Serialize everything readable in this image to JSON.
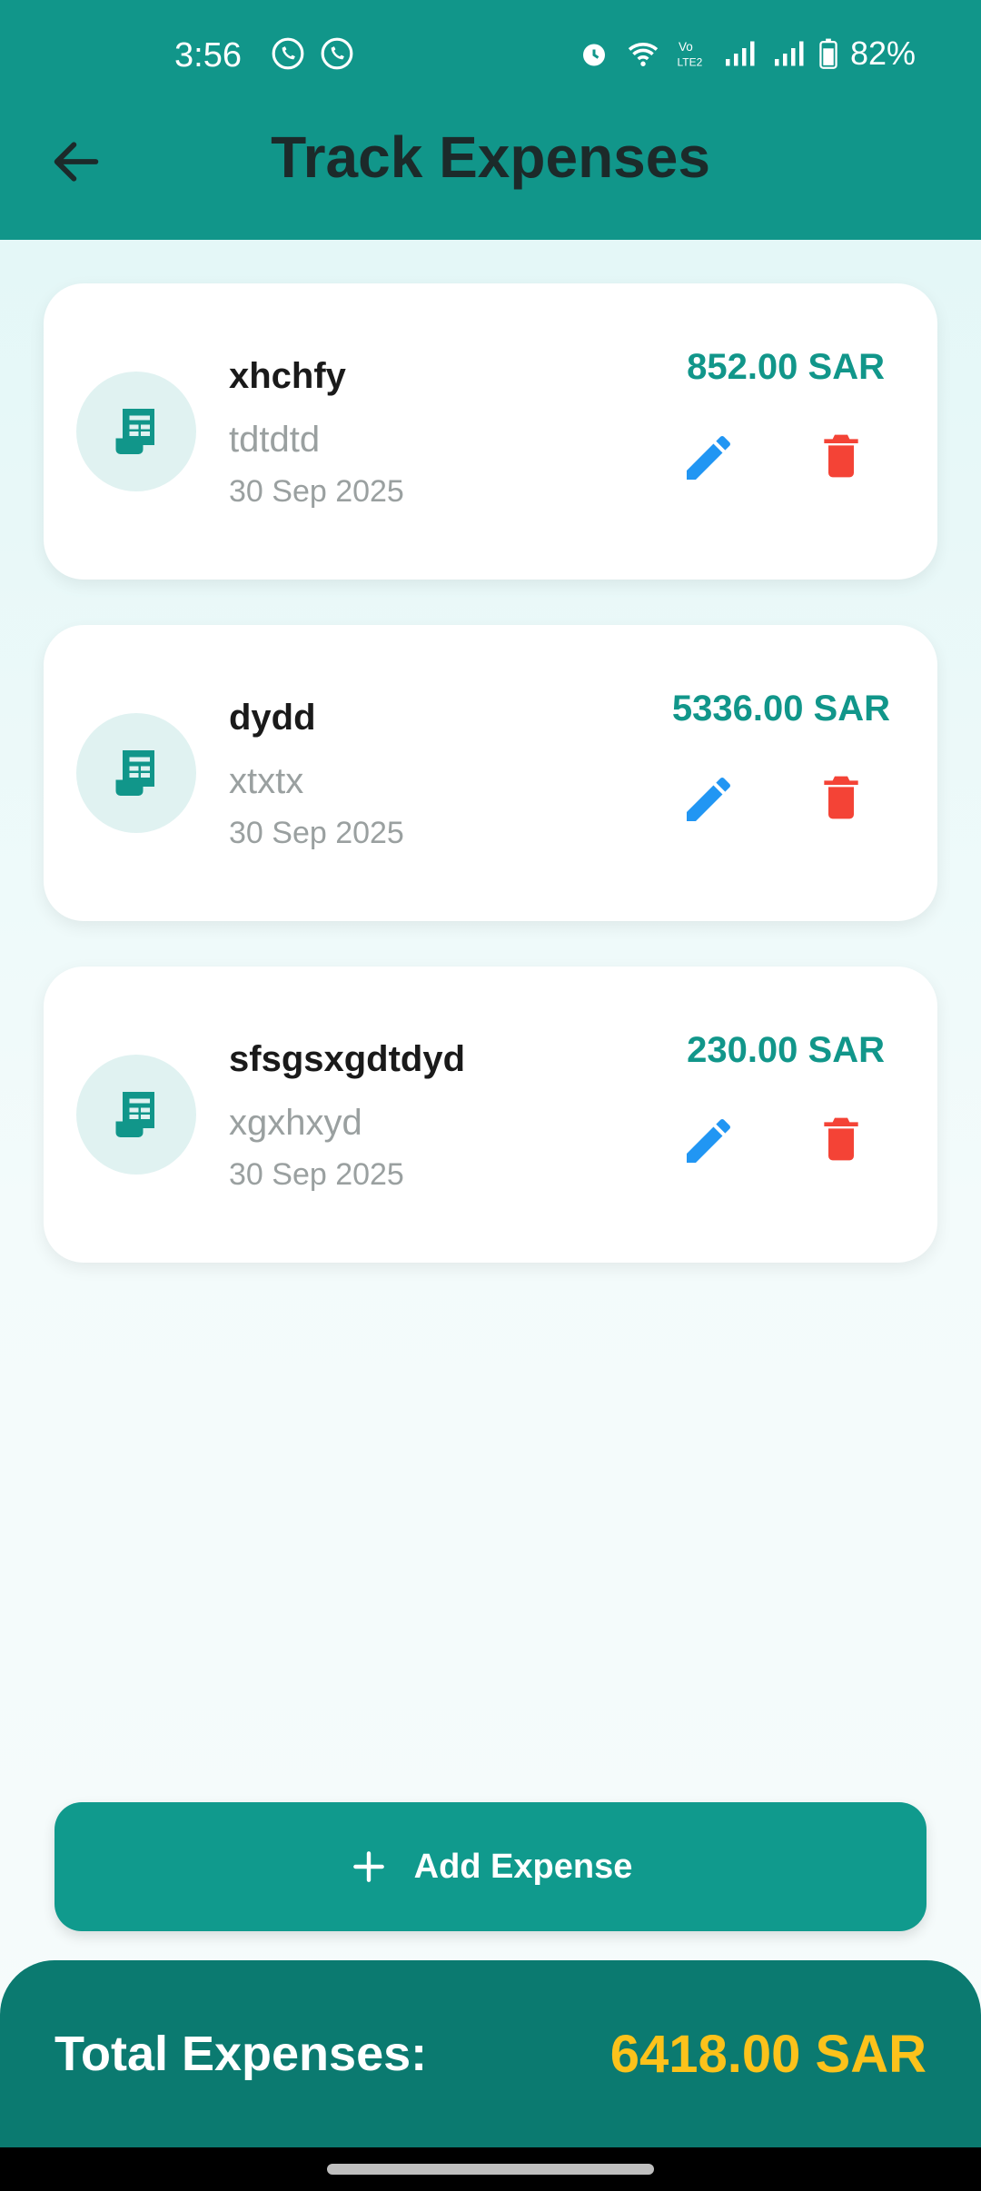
{
  "status_bar": {
    "time": "3:56",
    "battery": "82%",
    "icons": [
      "whatsapp-icon",
      "whatsapp-icon",
      "alarm-icon",
      "wifi-icon",
      "volte-icon",
      "signal-icon",
      "signal-icon",
      "battery-icon"
    ]
  },
  "header": {
    "title": "Track Expenses"
  },
  "expenses": [
    {
      "name": "xhchfy",
      "description": "tdtdtd",
      "date": "30 Sep 2025",
      "amount": "852.00 SAR"
    },
    {
      "name": "dydd",
      "description": "xtxtx",
      "date": "30 Sep 2025",
      "amount": "5336.00 SAR"
    },
    {
      "name": "sfsgsxgdtdyd",
      "description": "xgxhxyd",
      "date": "30 Sep 2025",
      "amount": "230.00 SAR"
    }
  ],
  "add_button": {
    "label": "Add Expense"
  },
  "footer": {
    "label": "Total Expenses:",
    "total": "6418.00 SAR"
  },
  "colors": {
    "primary": "#11968a",
    "edit": "#2196f3",
    "delete": "#f44336",
    "total": "#fcc21b"
  }
}
